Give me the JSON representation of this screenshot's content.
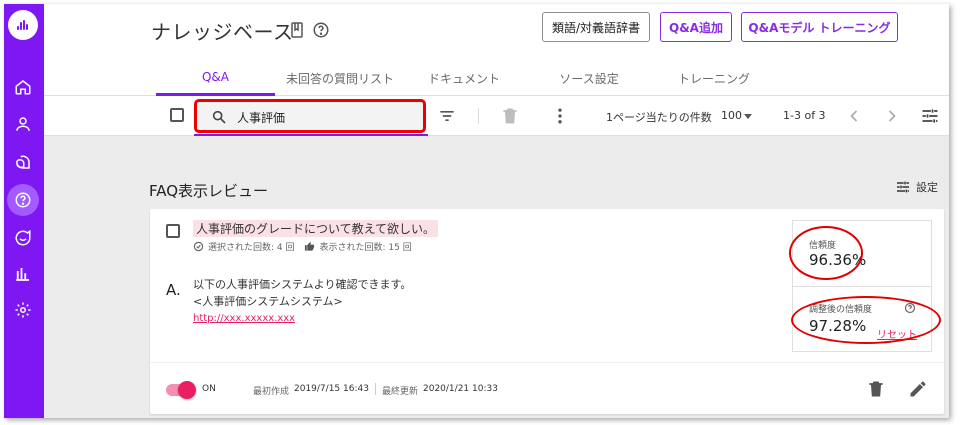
{
  "page": {
    "title": "ナレッジベース"
  },
  "header_buttons": {
    "synonyms": "類語/対義語辞書",
    "add_qa": "Q&A追加",
    "train_model": "Q&Aモデル トレーニング"
  },
  "tabs": [
    {
      "label": "Q&A",
      "active": true
    },
    {
      "label": "未回答の質問リスト",
      "active": false
    },
    {
      "label": "ドキュメント",
      "active": false
    },
    {
      "label": "ソース設定",
      "active": false
    },
    {
      "label": "トレーニング",
      "active": false
    }
  ],
  "toolbar": {
    "search_value": "人事評価",
    "per_page_label": "1ページ当たりの件数",
    "per_page_value": "100",
    "range": "1-3 of 3"
  },
  "section": {
    "title": "FAQ表示レビュー",
    "settings_label": "設定"
  },
  "faq": {
    "question": "人事評価のグレードについて教えて欲しい。",
    "selected_count": "選択された回数: 4 回",
    "shown_count": "表示された回数: 15 回",
    "answer_marker": "A.",
    "answer_lines": [
      "以下の人事評価システムより確認できます。",
      "<人事評価システムシステム>"
    ],
    "answer_link": "http://xxx.xxxxx.xxx",
    "confidence_label": "信頼度",
    "confidence_value": "96.36%",
    "adjusted_label": "調整後の信頼度",
    "adjusted_value": "97.28%",
    "reset_label": "リセット",
    "toggle_label": "ON",
    "created_label": "最初作成",
    "created_value": "2019/7/15 16:43",
    "updated_label": "最終更新",
    "updated_value": "2020/1/21 10:33"
  },
  "colors": {
    "brand": "#7e17f2",
    "accent": "#e91e63",
    "highlight": "#ee0000"
  },
  "icons": {
    "rail": [
      "logo-icon",
      "home-icon",
      "user-icon",
      "chat-icon",
      "help-circle-icon",
      "conversation-icon",
      "bar-chart-icon",
      "gear-icon"
    ],
    "toolbar": [
      "search-icon",
      "filter-icon",
      "delete-icon",
      "more-vert-icon",
      "chevron-left-icon",
      "chevron-right-icon",
      "tune-icon"
    ]
  }
}
